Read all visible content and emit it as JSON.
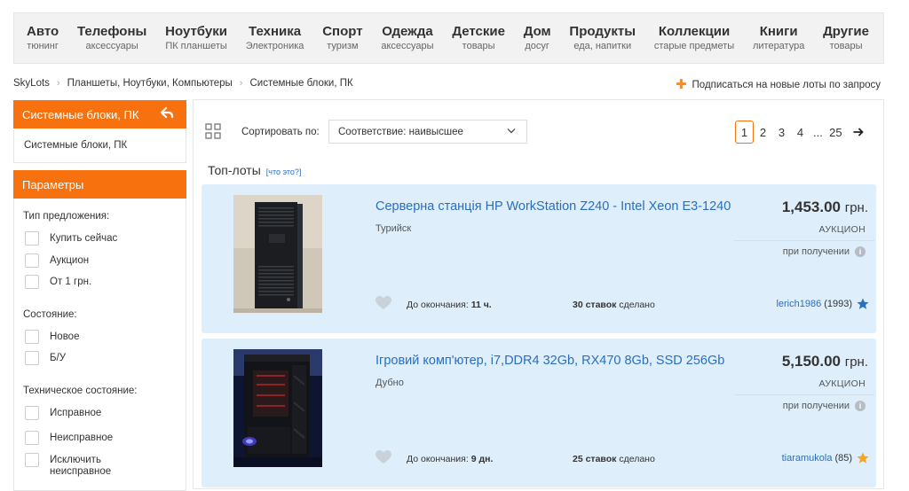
{
  "nav": [
    {
      "title": "Авто",
      "sub": "тюнинг"
    },
    {
      "title": "Телефоны",
      "sub": "аксессуары"
    },
    {
      "title": "Ноутбуки",
      "sub": "ПК планшеты"
    },
    {
      "title": "Техника",
      "sub": "Электроника"
    },
    {
      "title": "Спорт",
      "sub": "туризм"
    },
    {
      "title": "Одежда",
      "sub": "аксессуары"
    },
    {
      "title": "Детские",
      "sub": "товары"
    },
    {
      "title": "Дом",
      "sub": "досуг"
    },
    {
      "title": "Продукты",
      "sub": "еда, напитки"
    },
    {
      "title": "Коллекции",
      "sub": "старые предметы"
    },
    {
      "title": "Книги",
      "sub": "литература"
    },
    {
      "title": "Другие",
      "sub": "товары"
    }
  ],
  "breadcrumb": [
    "SkyLots",
    "Планшеты, Ноутбуки, Компьютеры",
    "Системные блоки, ПК"
  ],
  "subscribe_label": "Подписаться на новые лоты по запросу",
  "sidebar": {
    "category_header": "Системные блоки, ПК",
    "category_item": "Системные блоки, ПК",
    "params_header": "Параметры",
    "groups": [
      {
        "label": "Тип предложения:",
        "options": [
          "Купить сейчас",
          "Аукцион",
          "От 1 грн."
        ]
      },
      {
        "label": "Состояние:",
        "options": [
          "Новое",
          "Б/У"
        ]
      },
      {
        "label": "Техническое состояние:",
        "options": [
          "Исправное",
          "Неисправное",
          "Исключить неисправное"
        ]
      }
    ]
  },
  "toolbar": {
    "sort_label": "Сортировать по:",
    "sort_value_bold": "Соответствие:",
    "sort_value": " наивысшее",
    "pages": [
      "1",
      "2",
      "3",
      "4"
    ],
    "dots": "...",
    "last_page": "25",
    "current_page": 1
  },
  "toplots": {
    "title": "Топ-лоты",
    "hint": "[что это?]"
  },
  "lots": [
    {
      "title": "Серверна станція HP WorkStation Z240 - Intel Xeon E3-1240",
      "city": "Турийск",
      "price": "1,453.00",
      "currency": "грн.",
      "type": "АУКЦИОН",
      "payment": "при получении",
      "ends_label": "До окончания:",
      "ends_value": "11 ч.",
      "bids_count": "30 ставок",
      "bids_suffix": "сделано",
      "seller": "lerich1986",
      "rating": "(1993)",
      "star_color": "#2a6ec0"
    },
    {
      "title": "Ігровий комп'ютер, i7,DDR4 32Gb, RX470 8Gb, SSD 256Gb",
      "city": "Дубно",
      "price": "5,150.00",
      "currency": "грн.",
      "type": "АУКЦИОН",
      "payment": "при получении",
      "ends_label": "До окончания:",
      "ends_value": "9 дн.",
      "bids_count": "25 ставок",
      "bids_suffix": "сделано",
      "seller": "tiaramukola",
      "rating": "(85)",
      "star_color": "#f5a623"
    }
  ],
  "colors": {
    "accent": "#f7720f",
    "link": "#2a6ec0",
    "lot_bg": "#dfeefb"
  }
}
